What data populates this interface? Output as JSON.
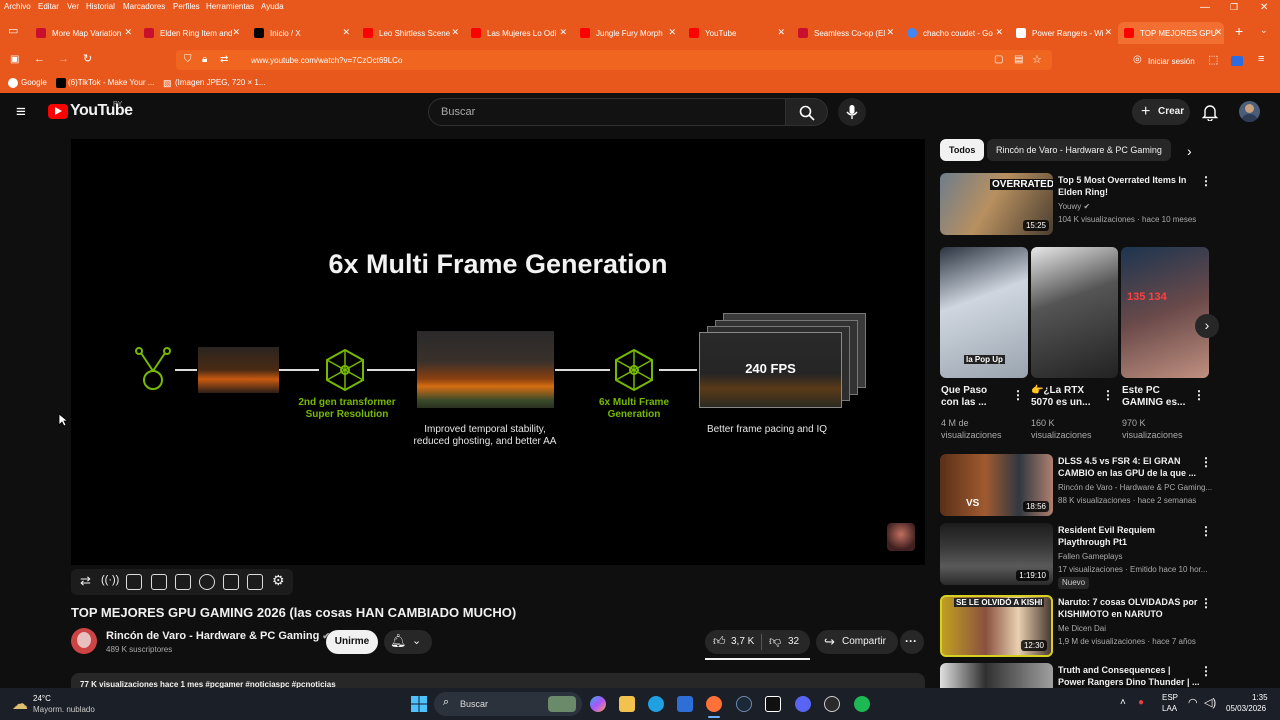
{
  "menu": [
    "Archivo",
    "Editar",
    "Ver",
    "Historial",
    "Marcadores",
    "Perfiles",
    "Herramientas",
    "Ayuda"
  ],
  "tabs": [
    {
      "label": "More Map Variation",
      "color": "#c8102e"
    },
    {
      "label": "Elden Ring Item and",
      "color": "#c8102e"
    },
    {
      "label": "Inicio / X",
      "color": "#000000"
    },
    {
      "label": "Leo Shirtless Scene",
      "color": "#ff0000"
    },
    {
      "label": "Las Mujeres Lo Odi",
      "color": "#ff0000"
    },
    {
      "label": "Jungle Fury Morph",
      "color": "#ff0000"
    },
    {
      "label": "YouTube",
      "color": "#ff0000"
    },
    {
      "label": "Seamless Co-op (El",
      "color": "#c8102e"
    },
    {
      "label": "chacho coudet - Go",
      "color": "#4285f4"
    },
    {
      "label": "Power Rangers - Wi",
      "color": "#ffffff"
    },
    {
      "label": "TOP MEJORES GPU",
      "color": "#ff0000"
    }
  ],
  "url": "www.youtube.com/watch?v=7CzOct69LCo",
  "signin": "Iniciar sesión",
  "bookmarks": [
    "Google",
    "(6)TikTok - Make Your ...",
    "(Imagen JPEG, 720 × 1..."
  ],
  "yt": {
    "logo": "YouTube",
    "region": "PY",
    "search_placeholder": "Buscar",
    "create": "Crear"
  },
  "slide": {
    "heading": "6x Multi Frame Generation",
    "label1": "2nd gen transformer",
    "label1b": "Super Resolution",
    "caption1": "Improved temporal stability,",
    "caption1b": "reduced ghosting, and better AA",
    "label2": "6x Multi Frame",
    "label2b": "Generation",
    "fps": "240 FPS",
    "caption2": "Better frame pacing and IQ"
  },
  "video": {
    "title": "TOP MEJORES GPU GAMING 2026 (las cosas HAN CAMBIADO MUCHO)",
    "channel": "Rincón de Varo - Hardware & PC Gaming",
    "subs": "489 K suscriptores",
    "join": "Unirme",
    "likes": "3,7 K",
    "dislikes": "32",
    "share": "Compartir",
    "desc": "77 K visualizaciones  hace 1 mes  #pcgamer #noticiaspc #pcnoticias"
  },
  "chips": [
    "Todos",
    "Rincón de Varo - Hardware & PC Gaming"
  ],
  "sidebar": [
    {
      "title1": "Top 5 Most Overrated Items In",
      "title2": "Elden Ring!",
      "channel": "Youwy",
      "meta": "104 K visualizaciones · hace 10 meses",
      "duration": "15:25",
      "thumb_text": "OVERRATED"
    },
    {
      "title1": "DLSS 4.5 vs FSR 4: El GRAN",
      "title2": "CAMBIO en las GPU de la que ...",
      "channel": "Rincón de Varo - Hardware & PC Gaming...",
      "meta": "88 K visualizaciones · hace 2 semanas",
      "duration": "18:56",
      "thumb_text": "VS"
    },
    {
      "title1": "Resident Evil Requiem",
      "title2": "Playthrough Pt1",
      "channel": "Fallen Gameplays",
      "meta": "17 visualizaciones · Emitido hace 10 hor...",
      "duration": "1:19:10",
      "badge": "Nuevo"
    },
    {
      "title1": "Naruto: 7 cosas OLVIDADAS por",
      "title2": "KISHIMOTO en NARUTO",
      "channel": "Me Dicen Dai",
      "meta": "1,9 M de visualizaciones · hace 7 años",
      "duration": "12:30",
      "thumb_text": "SE LE OLVIDÓ A KISHI"
    },
    {
      "title1": "Truth and Consequences |",
      "title2": "Power Rangers Dino Thunder | ..."
    }
  ],
  "shorts": [
    {
      "title1": "Que Paso",
      "title2": "con las ...",
      "meta1": "4 M de",
      "meta2": "visualizaciones",
      "thumb_text": "la Pop Up"
    },
    {
      "title1": "👉¿La RTX",
      "title2": "5070 es un...",
      "meta1": "160 K",
      "meta2": "visualizaciones"
    },
    {
      "title1": "Este PC",
      "title2": "GAMING es...",
      "meta1": "970 K",
      "meta2": "visualizaciones",
      "thumb_text": "135  134"
    }
  ],
  "taskbar": {
    "temp": "24°C",
    "weather": "Mayorm. nublado",
    "search": "Buscar",
    "lang1": "ESP",
    "lang2": "LAA",
    "time": "1:35",
    "date": "05/03/2026"
  }
}
